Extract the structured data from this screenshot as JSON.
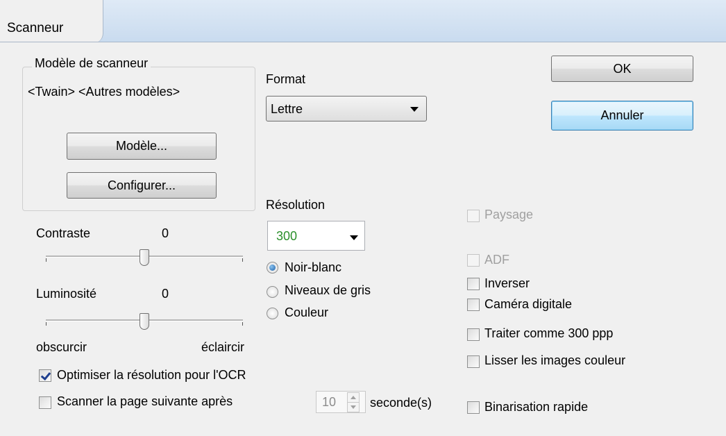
{
  "window": {
    "title": "Scanneur"
  },
  "scanner_model": {
    "group_label": "Modèle de scanneur",
    "current": "<Twain> <Autres modèles>",
    "model_button": "Modèle...",
    "configure_button": "Configurer..."
  },
  "format": {
    "label": "Format",
    "value": "Lettre"
  },
  "resolution": {
    "label": "Résolution",
    "value": "300",
    "value_color": "#2a8f2a"
  },
  "color_mode": {
    "options": [
      "Noir-blanc",
      "Niveaux de gris",
      "Couleur"
    ],
    "selected": "Noir-blanc"
  },
  "contrast": {
    "label": "Contraste",
    "value": "0"
  },
  "brightness": {
    "label": "Luminosité",
    "value": "0",
    "min_label": "obscurcir",
    "max_label": "éclaircir"
  },
  "actions": {
    "ok": "OK",
    "cancel": "Annuler"
  },
  "options": {
    "landscape": {
      "label": "Paysage",
      "checked": false,
      "enabled": false
    },
    "adf": {
      "label": "ADF",
      "checked": false,
      "enabled": false
    },
    "invert": {
      "label": "Inverser",
      "checked": false
    },
    "digital_camera": {
      "label": "Caméra digitale",
      "checked": false
    },
    "treat_300dpi": {
      "label": "Traiter comme 300 ppp",
      "checked": false
    },
    "smooth_color": {
      "label": "Lisser les images couleur",
      "checked": false
    },
    "fast_binarization": {
      "label": "Binarisation rapide",
      "checked": false
    },
    "optimize_ocr": {
      "label": "Optimiser la résolution pour l'OCR",
      "checked": true
    },
    "scan_next_page": {
      "label": "Scanner la page suivante après",
      "checked": false
    }
  },
  "delay": {
    "value": "10",
    "unit": "seconde(s)"
  }
}
